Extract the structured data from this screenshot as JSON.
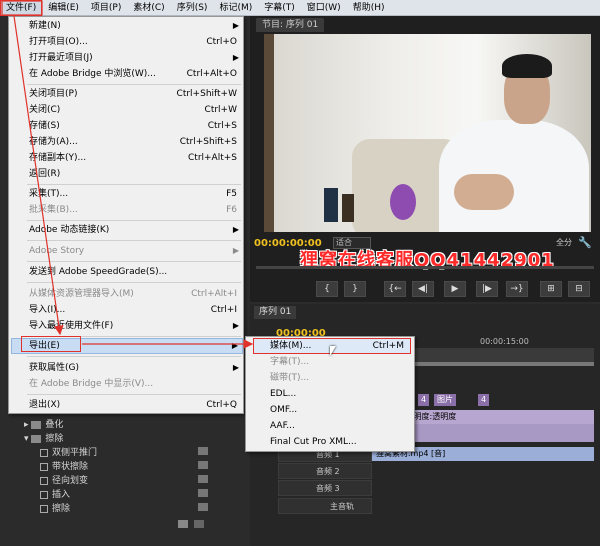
{
  "menubar": [
    {
      "label": "文件(F)",
      "active": true
    },
    {
      "label": "编辑(E)"
    },
    {
      "label": "项目(P)"
    },
    {
      "label": "素材(C)"
    },
    {
      "label": "序列(S)"
    },
    {
      "label": "标记(M)"
    },
    {
      "label": "字幕(T)"
    },
    {
      "label": "窗口(W)"
    },
    {
      "label": "帮助(H)"
    }
  ],
  "file_menu": {
    "new": {
      "label": "新建(N)"
    },
    "open_project": {
      "label": "打开项目(O)...",
      "shortcut": "Ctrl+O"
    },
    "open_recent": {
      "label": "打开最近项目(J)"
    },
    "browse_bridge": {
      "label": "在 Adobe Bridge 中浏览(W)...",
      "shortcut": "Ctrl+Alt+O"
    },
    "close_project": {
      "label": "关闭项目(P)",
      "shortcut": "Ctrl+Shift+W"
    },
    "close": {
      "label": "关闭(C)",
      "shortcut": "Ctrl+W"
    },
    "save": {
      "label": "存储(S)",
      "shortcut": "Ctrl+S"
    },
    "save_as": {
      "label": "存储为(A)...",
      "shortcut": "Ctrl+Shift+S"
    },
    "save_copy": {
      "label": "存储副本(Y)...",
      "shortcut": "Ctrl+Alt+S"
    },
    "revert": {
      "label": "返回(R)"
    },
    "capture": {
      "label": "采集(T)...",
      "shortcut": "F5"
    },
    "batch_capture": {
      "label": "批采集(B)...",
      "shortcut": "F6"
    },
    "dynamic_link": {
      "label": "Adobe 动态链接(K)"
    },
    "adobe_story": {
      "label": "Adobe Story"
    },
    "speedgrade": {
      "label": "发送到 Adobe SpeedGrade(S)..."
    },
    "import_media_browser": {
      "label": "从媒体资源管理器导入(M)",
      "shortcut": "Ctrl+Alt+I"
    },
    "import": {
      "label": "导入(I)...",
      "shortcut": "Ctrl+I"
    },
    "import_recent": {
      "label": "导入最近使用文件(F)"
    },
    "export": {
      "label": "导出(E)"
    },
    "get_properties": {
      "label": "获取属性(G)"
    },
    "reveal_bridge": {
      "label": "在 Adobe Bridge 中显示(V)..."
    },
    "exit": {
      "label": "退出(X)",
      "shortcut": "Ctrl+Q"
    }
  },
  "export_submenu": {
    "media": {
      "label": "媒体(M)...",
      "shortcut": "Ctrl+M"
    },
    "title": {
      "label": "字幕(T)..."
    },
    "tape": {
      "label": "磁带(T)..."
    },
    "edl": {
      "label": "EDL..."
    },
    "omf": {
      "label": "OMF..."
    },
    "aaf": {
      "label": "AAF..."
    },
    "fcp_xml": {
      "label": "Final Cut Pro XML..."
    }
  },
  "program_monitor": {
    "tab": "节目: 序列 01",
    "timecode": "00:00:00:00",
    "fit": "适合",
    "quality": "全分",
    "watermark": "狸窝在线客服QQ41442901"
  },
  "transport_buttons": [
    "{",
    "}",
    "{←",
    "◀|",
    "▶",
    "|▶",
    "→}",
    "⊞",
    "⊟"
  ],
  "timeline": {
    "tab": "序列 01",
    "timecode": "00:00:00",
    "ruler_time": "00:00:15:00",
    "clips_top": [
      "4",
      "图片",
      "4"
    ],
    "video_clip": "p4 [视] 透明度:透明度",
    "audio_clip": "狸窝素材.mp4 [音]",
    "tracks": [
      {
        "label": "音频 1"
      },
      {
        "label": "音频 2"
      },
      {
        "label": "音频 3"
      },
      {
        "label": "主音轨"
      }
    ]
  },
  "effects_panel": {
    "items": [
      {
        "label": "叠化",
        "type": "folder",
        "expanded": false
      },
      {
        "label": "擦除",
        "type": "folder",
        "expanded": true
      },
      {
        "label": "双侧平推门",
        "type": "effect"
      },
      {
        "label": "带状擦除",
        "type": "effect"
      },
      {
        "label": "径向划变",
        "type": "effect"
      },
      {
        "label": "插入",
        "type": "effect"
      },
      {
        "label": "擦除",
        "type": "effect"
      }
    ]
  },
  "colors": {
    "annotation": "#e0322b",
    "timecode": "#f0c020",
    "highlight": "#c8dcf3"
  }
}
